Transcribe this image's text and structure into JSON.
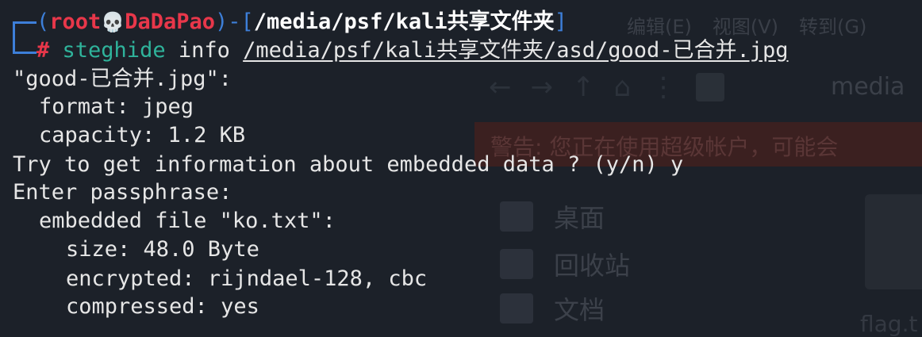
{
  "background": {
    "menu": [
      "编辑(E)",
      "视图(V)",
      "转到(G)"
    ],
    "path_label": "media",
    "warning_text": "警告: 您正在使用超级帐户，可能会",
    "sidebar": [
      "桌面",
      "回收站",
      "文档"
    ],
    "file_label": "flag.t"
  },
  "prompt": {
    "user": "root",
    "skull_icon": "skull",
    "host": "DaDaPao",
    "cwd": "/media/psf/kali共享文件夹",
    "symbol": "#"
  },
  "command": {
    "program": "steghide",
    "args": "info",
    "path": "/media/psf/kali共享文件夹/asd/good-已合并.jpg"
  },
  "output": [
    "\"good-已合并.jpg\":",
    "format: jpeg",
    "capacity: 1.2 KB",
    "Try to get information about embedded data ? (y/n) y",
    "Enter passphrase:",
    "embedded file \"ko.txt\":",
    "size: 48.0 Byte",
    "encrypted: rijndael-128, cbc",
    "compressed: yes"
  ],
  "colors": {
    "background": "#1c2129",
    "prompt_bracket": "#3d7fd9",
    "prompt_user": "#e8374a",
    "command": "#2fb39b",
    "text": "#e6e6e6"
  }
}
